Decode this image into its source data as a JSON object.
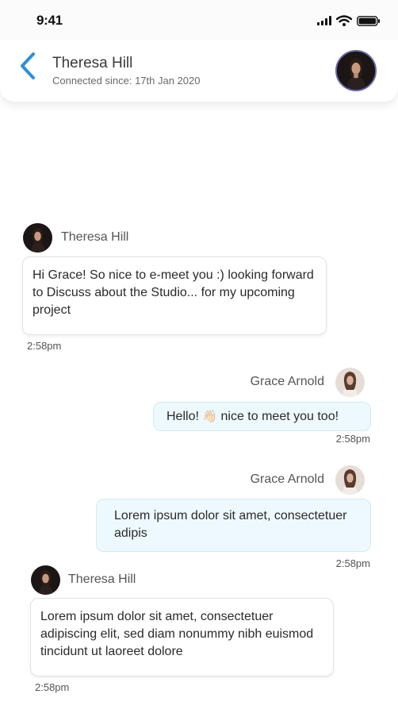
{
  "status_bar": {
    "time": "9:41"
  },
  "header": {
    "contact_name": "Theresa Hill",
    "connected_since": "Connected since: 17th Jan 2020"
  },
  "messages": [
    {
      "sender": "Theresa Hill",
      "direction": "incoming",
      "text": "Hi Grace! So nice to e-meet you :) looking forward to Discuss about the Studio... for my upcoming project",
      "time": "2:58pm"
    },
    {
      "sender": "Grace Arnold",
      "direction": "outgoing",
      "text_before_emoji": "Hello!",
      "emoji": "👋🏻",
      "text_after_emoji": "nice to meet you too!",
      "time": "2:58pm"
    },
    {
      "sender": "Grace Arnold",
      "direction": "outgoing",
      "text": "Lorem ipsum dolor sit amet, consectetuer adipis",
      "time": "2:58pm"
    },
    {
      "sender": "Theresa Hill",
      "direction": "incoming",
      "text": "Lorem ipsum dolor sit amet, consectetuer adipiscing elit, sed diam nonummy nibh euismod tincidunt ut laoreet dolore",
      "time": "2:58pm"
    }
  ],
  "colors": {
    "accent": "#2f8fd6",
    "incoming_bubble": "#ffffff",
    "outgoing_bubble": "#eef9ff"
  }
}
